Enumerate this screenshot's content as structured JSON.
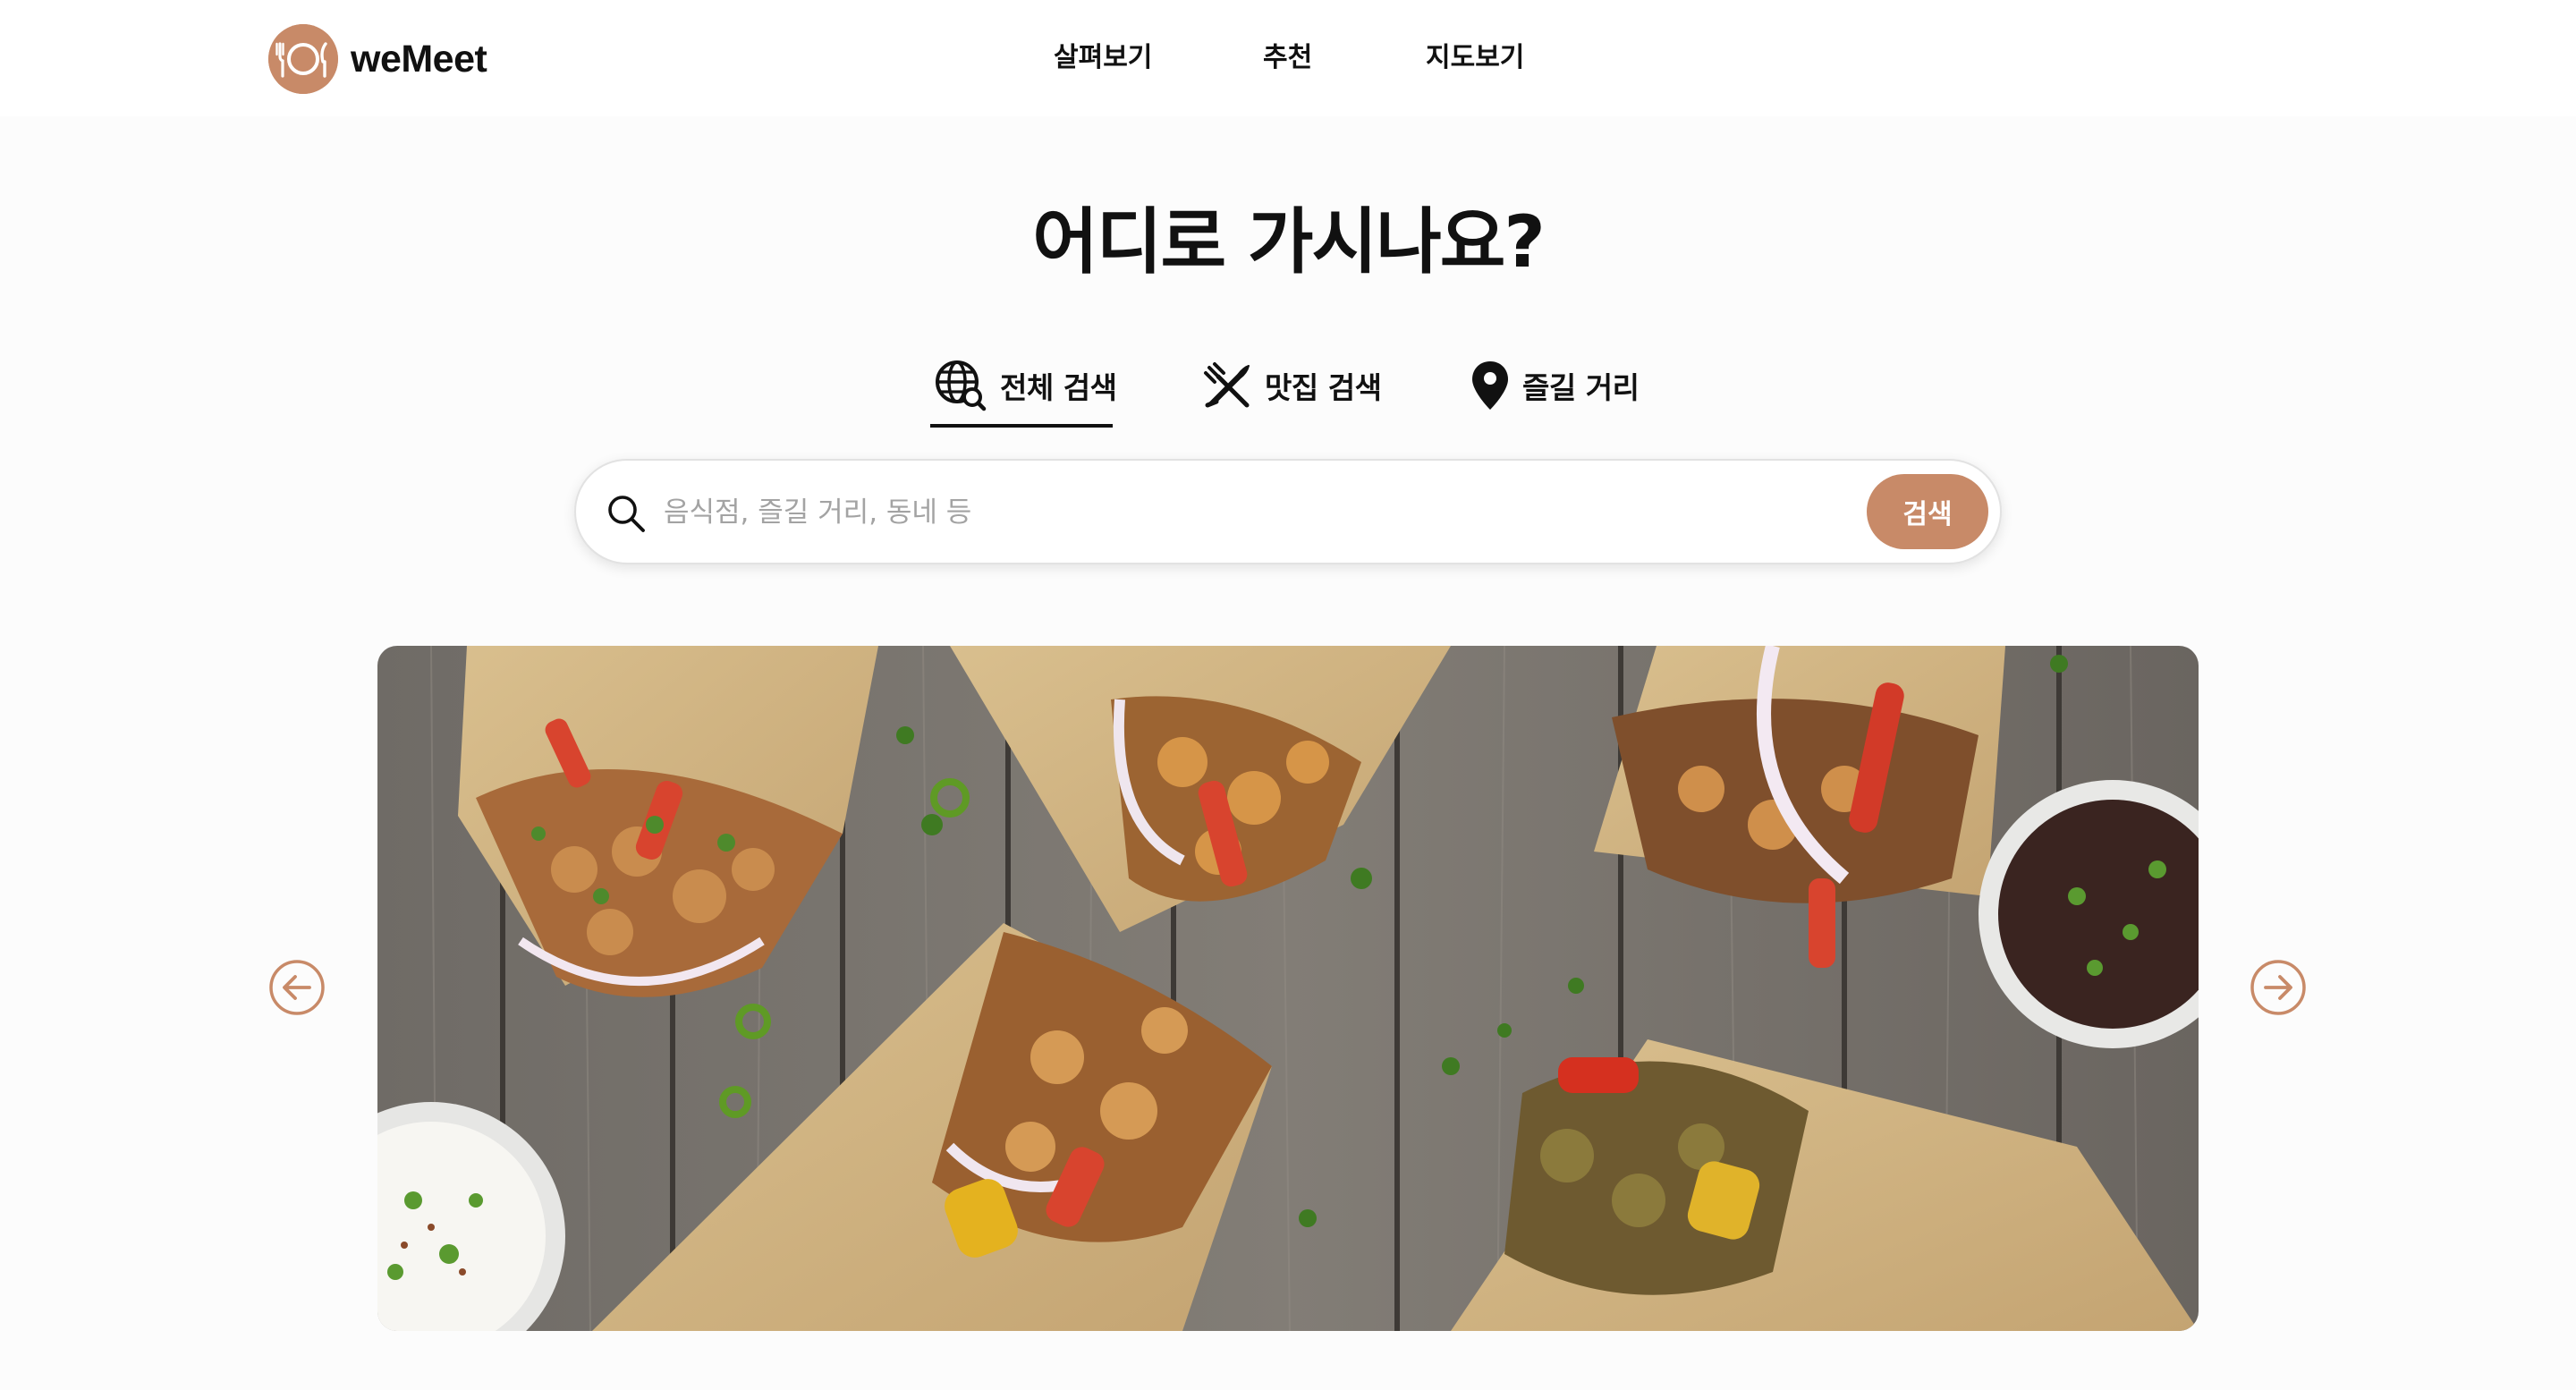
{
  "app": {
    "name": "weMeet",
    "accent_color": "#c88a68"
  },
  "header": {
    "logo_icon": "plate-fork-knife-icon",
    "nav": [
      {
        "label": "살펴보기"
      },
      {
        "label": "추천"
      },
      {
        "label": "지도보기"
      }
    ]
  },
  "hero": {
    "title": "어디로 가시나요?"
  },
  "search": {
    "tabs": [
      {
        "label": "전체 검색",
        "icon": "globe-search-icon",
        "active": true
      },
      {
        "label": "맛집 검색",
        "icon": "fork-knife-icon",
        "active": false
      },
      {
        "label": "즐길 거리",
        "icon": "map-pin-icon",
        "active": false
      }
    ],
    "placeholder": "음식점, 즐길 거리, 동네 등",
    "value": "",
    "button_label": "검색",
    "icon": "search-icon"
  },
  "carousel": {
    "prev_icon": "arrow-left-circle-icon",
    "next_icon": "arrow-right-circle-icon",
    "image_subject": "tortilla wraps with grilled chicken and vegetables on wooden table"
  }
}
